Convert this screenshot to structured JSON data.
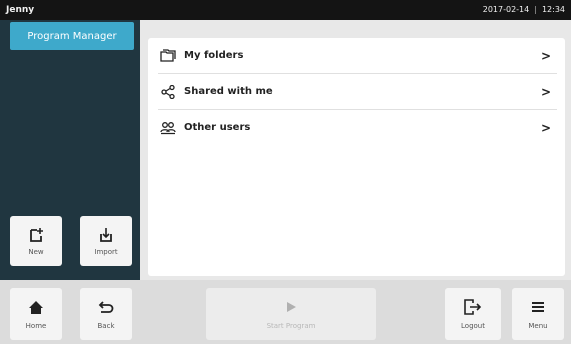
{
  "status_bar": {
    "user": "Jenny",
    "date": "2017-02-14",
    "separator": "|",
    "time": "12:34"
  },
  "sidebar": {
    "program_manager_label": "Program Manager",
    "new_label": "New",
    "import_label": "Import"
  },
  "list": {
    "items": [
      {
        "label": "My folders",
        "icon": "folders-icon",
        "chevron": ">"
      },
      {
        "label": "Shared with me",
        "icon": "share-icon",
        "chevron": ">"
      },
      {
        "label": "Other users",
        "icon": "users-icon",
        "chevron": ">"
      }
    ]
  },
  "toolbar": {
    "home_label": "Home",
    "back_label": "Back",
    "start_label": "Start Program",
    "logout_label": "Logout",
    "menu_label": "Menu"
  },
  "colors": {
    "accent": "#3ea9cb",
    "sidebar": "#203640",
    "topbar": "#141414"
  }
}
